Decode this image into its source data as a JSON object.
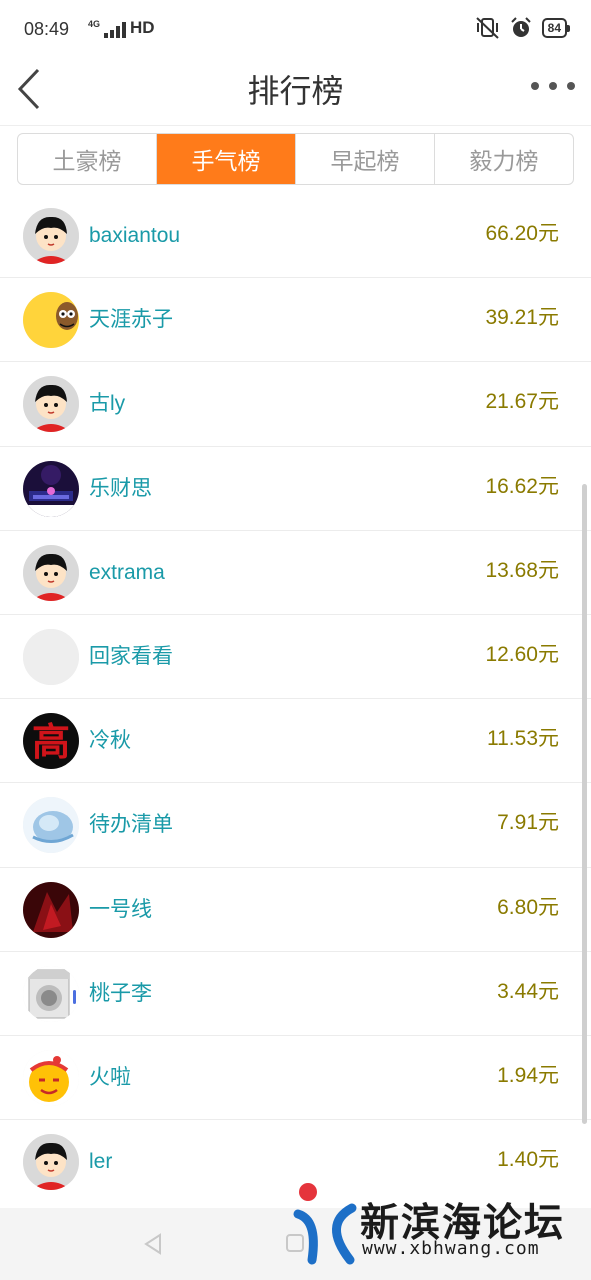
{
  "status": {
    "time": "08:49",
    "network": "4G",
    "hd": "HD",
    "battery": "84"
  },
  "header": {
    "title": "排行榜",
    "back_icon": "chevron-left-icon",
    "more_icon": "more-dots-icon"
  },
  "tabs": [
    {
      "label": "土豪榜",
      "active": false
    },
    {
      "label": "手气榜",
      "active": true
    },
    {
      "label": "早起榜",
      "active": false
    },
    {
      "label": "毅力榜",
      "active": false
    }
  ],
  "leaderboard": [
    {
      "name": "baxiantou",
      "amount": "66.20元",
      "avatar": "cartoon-boy"
    },
    {
      "name": "天涯赤子",
      "amount": "39.21元",
      "avatar": "yellow-cartoon"
    },
    {
      "name": "古ly",
      "amount": "21.67元",
      "avatar": "cartoon-boy"
    },
    {
      "name": "乐财思",
      "amount": "16.62元",
      "avatar": "night-city"
    },
    {
      "name": "extrama",
      "amount": "13.68元",
      "avatar": "cartoon-boy"
    },
    {
      "name": "回家看看",
      "amount": "12.60元",
      "avatar": "blank"
    },
    {
      "name": "冷秋",
      "amount": "11.53元",
      "avatar": "red-character"
    },
    {
      "name": "待办清单",
      "amount": "7.91元",
      "avatar": "blue-abstract"
    },
    {
      "name": "一号线",
      "amount": "6.80元",
      "avatar": "dark-red"
    },
    {
      "name": "桃子李",
      "amount": "3.44元",
      "avatar": "washing-machine"
    },
    {
      "name": "火啦",
      "amount": "1.94元",
      "avatar": "yellow-emoji"
    },
    {
      "name": "ler",
      "amount": "1.40元",
      "avatar": "cartoon-boy"
    }
  ],
  "watermark": {
    "title": "新滨海论坛",
    "url": "www.xbhwang.com"
  },
  "colors": {
    "accent": "#ff7b1a",
    "name": "#1a9aa8",
    "amount": "#8a7a00"
  }
}
